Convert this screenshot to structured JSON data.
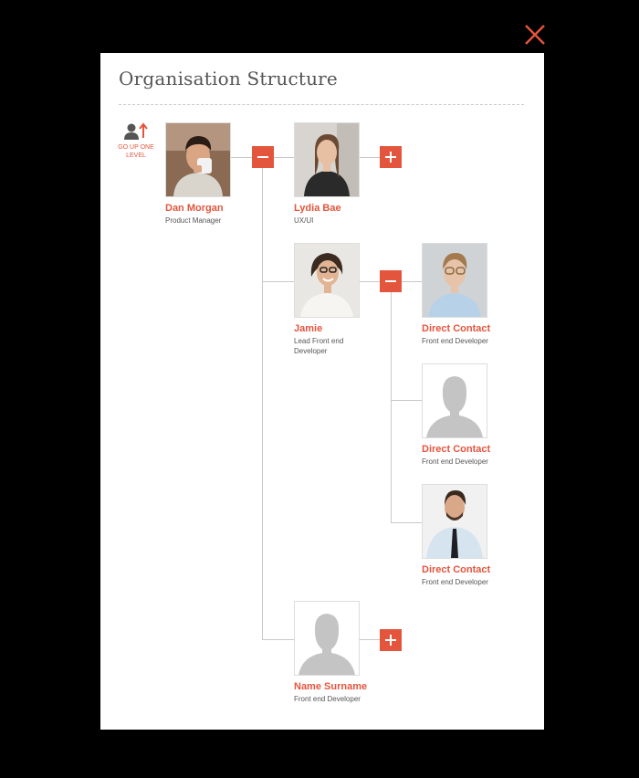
{
  "modal": {
    "title": "Organisation Structure",
    "go_up_label": "GO UP ONE LEVEL"
  },
  "colors": {
    "accent": "#e4553d",
    "placeholder": "#c4c4c4",
    "line": "#c8c8c8"
  },
  "root": {
    "name": "Dan Morgan",
    "role": "Product Manager",
    "photo": "man-drinking-coffee"
  },
  "reports": [
    {
      "name": "Lydia Bae",
      "role": "UX/UI",
      "photo": "woman-smiling",
      "toggle": "expand"
    },
    {
      "name": "Jamie",
      "role": "Lead Front end Developer",
      "photo": "woman-laughing-glasses",
      "toggle": "collapse"
    },
    {
      "name": "Name Surname",
      "role": "Front end Developer",
      "photo": "placeholder-silhouette",
      "toggle": "expand"
    }
  ],
  "sub_reports": [
    {
      "name": "Direct Contact",
      "role": "Front end Developer",
      "photo": "man-with-glasses"
    },
    {
      "name": "Direct Contact",
      "role": "Front end Developer",
      "photo": "placeholder-silhouette"
    },
    {
      "name": "Direct Contact",
      "role": "Front end Developer",
      "photo": "man-in-shirt-tie"
    }
  ]
}
